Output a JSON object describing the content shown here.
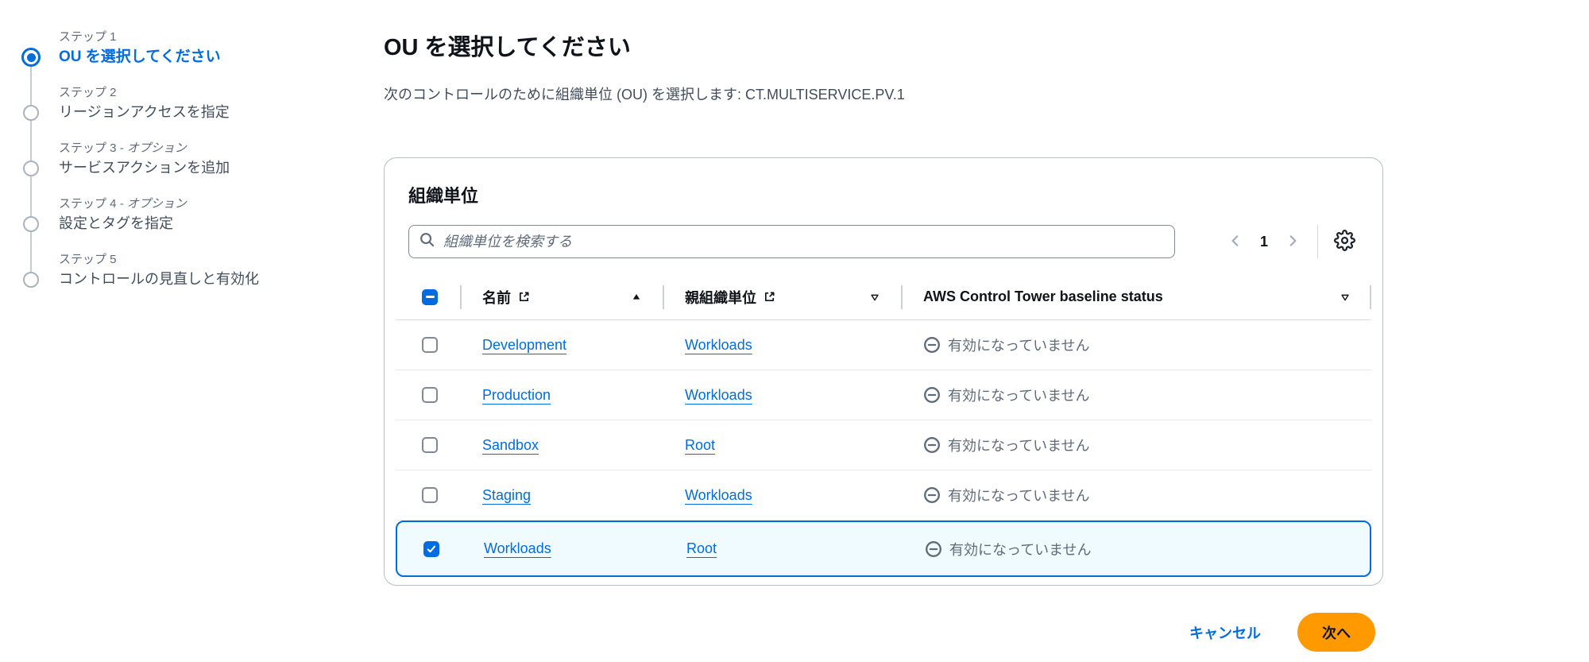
{
  "wizard": {
    "steps": [
      {
        "step_label": "ステップ 1",
        "optional_suffix": "",
        "title": "OU を選択してください",
        "state": "active"
      },
      {
        "step_label": "ステップ 2",
        "optional_suffix": "",
        "title": "リージョンアクセスを指定",
        "state": "upcoming"
      },
      {
        "step_label": "ステップ 3",
        "optional_suffix": " - オプション",
        "title": "サービスアクションを追加",
        "state": "upcoming"
      },
      {
        "step_label": "ステップ 4",
        "optional_suffix": " - オプション",
        "title": "設定とタグを指定",
        "state": "upcoming"
      },
      {
        "step_label": "ステップ 5",
        "optional_suffix": "",
        "title": "コントロールの見直しと有効化",
        "state": "upcoming"
      }
    ]
  },
  "page": {
    "title": "OU を選択してください",
    "subtitle": "次のコントロールのために組織単位 (OU) を選択します: CT.MULTISERVICE.PV.1"
  },
  "table": {
    "card_title": "組織単位",
    "search": {
      "placeholder": "組織単位を検索する",
      "value": ""
    },
    "pagination": {
      "current_page": "1"
    },
    "columns": {
      "name": "名前",
      "parent": "親組織単位",
      "status": "AWS Control Tower baseline status"
    },
    "rows": [
      {
        "name": "Development",
        "parent": "Workloads",
        "status": "有効になっていません",
        "checked": false
      },
      {
        "name": "Production",
        "parent": "Workloads",
        "status": "有効になっていません",
        "checked": false
      },
      {
        "name": "Sandbox",
        "parent": "Root",
        "status": "有効になっていません",
        "checked": false
      },
      {
        "name": "Staging",
        "parent": "Workloads",
        "status": "有効になっていません",
        "checked": false
      },
      {
        "name": "Workloads",
        "parent": "Root",
        "status": "有効になっていません",
        "checked": true
      }
    ]
  },
  "footer": {
    "cancel_label": "キャンセル",
    "next_label": "次へ"
  },
  "colors": {
    "accent_blue": "#006ce0",
    "primary_button_orange": "#ff9900",
    "selected_row_bg": "#f0fbff",
    "status_text_gray": "#5f6b7a",
    "card_border": "#b6bec9"
  }
}
